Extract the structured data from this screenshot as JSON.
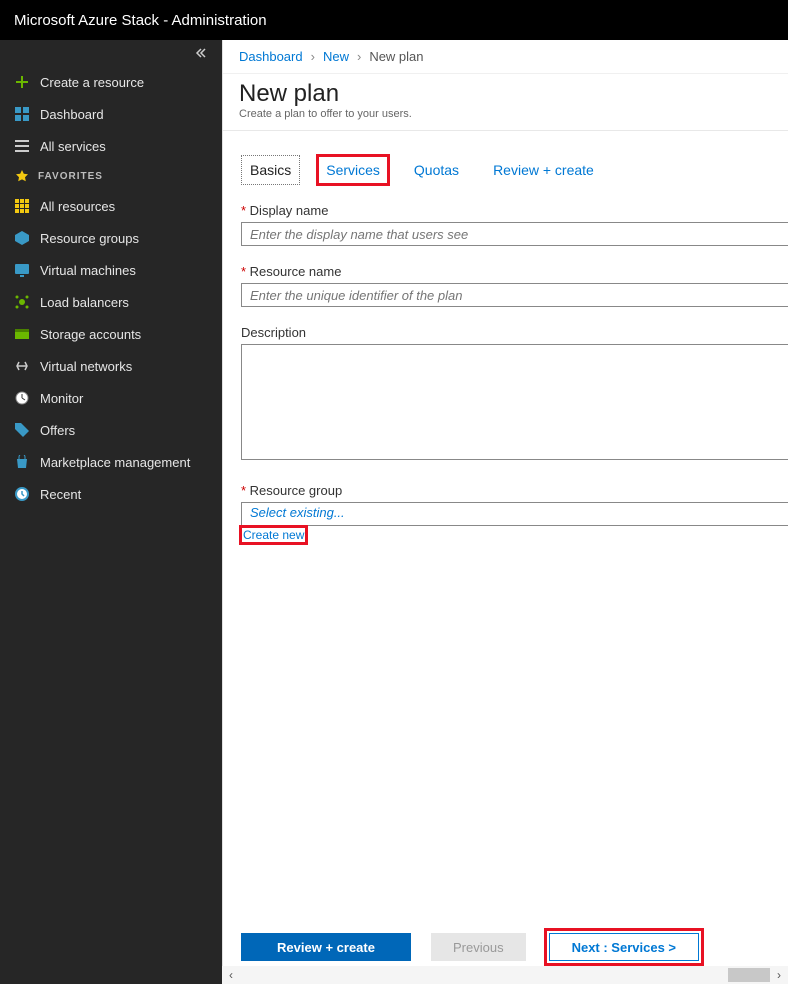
{
  "topbar": {
    "title": "Microsoft Azure Stack - Administration"
  },
  "sidebar": {
    "create": "Create a resource",
    "dashboard": "Dashboard",
    "all_services": "All services",
    "fav_header": "FAVORITES",
    "items": [
      {
        "label": "All resources"
      },
      {
        "label": "Resource groups"
      },
      {
        "label": "Virtual machines"
      },
      {
        "label": "Load balancers"
      },
      {
        "label": "Storage accounts"
      },
      {
        "label": "Virtual networks"
      },
      {
        "label": "Monitor"
      },
      {
        "label": "Offers"
      },
      {
        "label": "Marketplace management"
      },
      {
        "label": "Recent"
      }
    ]
  },
  "breadcrumbs": {
    "root": "Dashboard",
    "mid": "New",
    "current": "New plan"
  },
  "header": {
    "title": "New plan",
    "subtitle": "Create a plan to offer to your users."
  },
  "tabs": {
    "basics": "Basics",
    "services": "Services",
    "quotas": "Quotas",
    "review": "Review + create"
  },
  "form": {
    "display_name_label": "Display name",
    "display_name_placeholder": "Enter the display name that users see",
    "resource_name_label": "Resource name",
    "resource_name_placeholder": "Enter the unique identifier of the plan",
    "description_label": "Description",
    "resource_group_label": "Resource group",
    "resource_group_placeholder": "Select existing...",
    "create_new_link": "Create new"
  },
  "footer": {
    "review": "Review + create",
    "previous": "Previous",
    "next": "Next : Services >"
  }
}
